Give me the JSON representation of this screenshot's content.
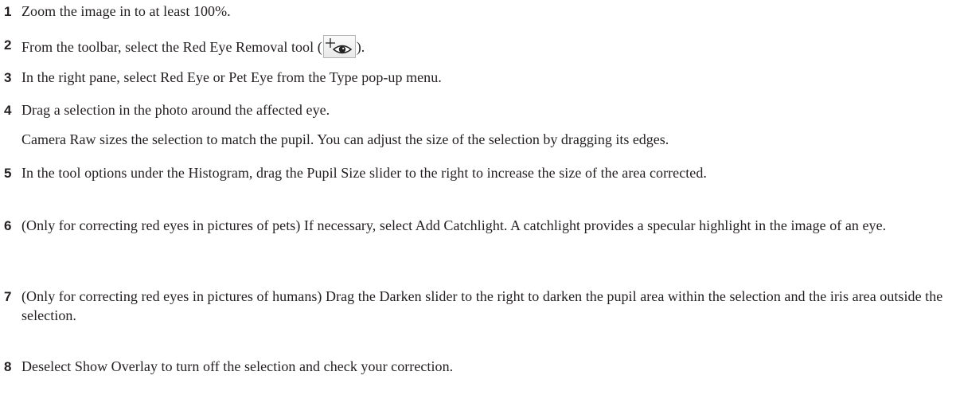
{
  "steps": [
    {
      "number": "1",
      "text": "Zoom the image in to at least 100%."
    },
    {
      "number": "2",
      "text_before": "From the toolbar, select the Red Eye Removal tool (",
      "icon": "red-eye-removal-icon",
      "text_after": ")."
    },
    {
      "number": "3",
      "text": "In the right pane, select Red Eye or Pet Eye from the Type pop-up menu."
    },
    {
      "number": "4",
      "text": "Drag a selection in the photo around the affected eye.",
      "note": "Camera Raw sizes the selection to match the pupil. You can adjust the size of the selection by dragging its edges."
    },
    {
      "number": "5",
      "text": "In the tool options under the Histogram, drag the Pupil Size slider to the right to increase the size of the area corrected."
    },
    {
      "number": "6",
      "text": "(Only for correcting red eyes in pictures of pets) If necessary, select Add Catchlight. A catchlight provides a specular highlight in the image of an eye."
    },
    {
      "number": "7",
      "text": "(Only for correcting red eyes in pictures of humans) Drag the Darken slider to the right to darken the pupil area within the selection and the iris area outside the selection."
    },
    {
      "number": "8",
      "text": "Deselect Show Overlay to turn off the selection and check your correction."
    }
  ]
}
